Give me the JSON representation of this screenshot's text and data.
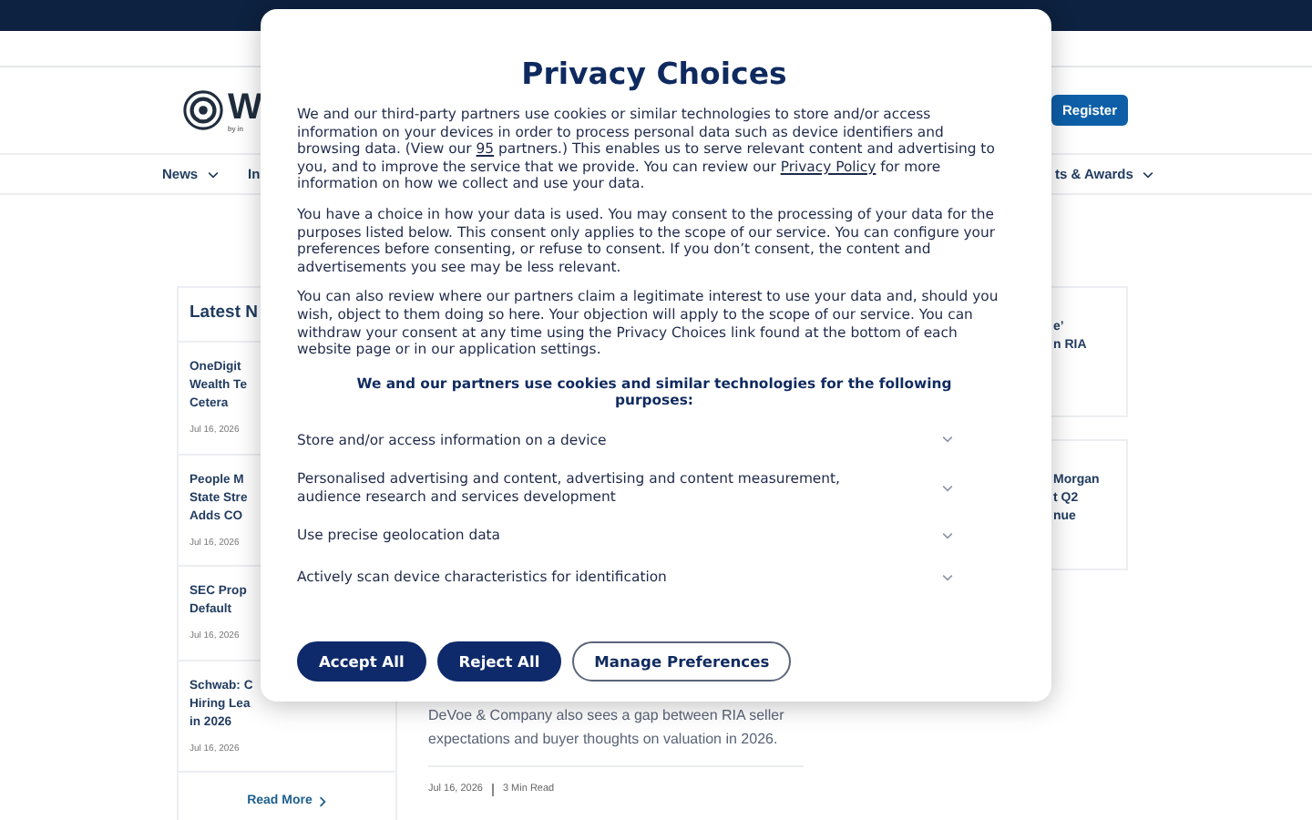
{
  "site": {
    "logo_letter": "W",
    "logo_tagline": "by in",
    "register": "Register",
    "nav": [
      {
        "label": "News",
        "dropdown": true
      },
      {
        "label": "In",
        "dropdown": false
      },
      {
        "label": "ts & Awards",
        "dropdown": true
      }
    ]
  },
  "latest": {
    "title": "Latest N",
    "items": [
      {
        "lines": [
          "OneDigit",
          "Wealth Te",
          "Cetera"
        ],
        "date": "Jul 16, 2026"
      },
      {
        "lines": [
          "People M",
          "State Stre",
          "Adds CO"
        ],
        "date": "Jul 16, 2026"
      },
      {
        "lines": [
          "SEC Prop",
          "Default"
        ],
        "date": "Jul 16, 2026"
      },
      {
        "lines": [
          "Schwab: C",
          "Hiring Lea",
          "in 2026"
        ],
        "date": "Jul 16, 2026"
      }
    ],
    "read_more": "Read More"
  },
  "right_cards": [
    {
      "lines": [
        "e’",
        "n RIA"
      ]
    },
    {
      "lines": [
        "Morgan",
        "t Q2",
        "nue"
      ]
    }
  ],
  "article": {
    "summary": "DeVoe & Company also sees a gap between RIA seller expectations and buyer thoughts on valuation in 2026.",
    "date": "Jul 16, 2026",
    "read_time": "3 Min Read"
  },
  "dialog": {
    "title": "Privacy Choices",
    "paragraphs": [
      [
        {
          "kind": "text",
          "text": "We and our third-party partners use cookies or similar technologies to store and/or access information on your devices in order to process personal data such as device identifiers and browsing data. (View our "
        },
        {
          "kind": "link",
          "text": "95"
        },
        {
          "kind": "text",
          "text": " partners.) This enables us to serve relevant content and advertising to you, and to improve the service that we provide. You can review our "
        },
        {
          "kind": "link",
          "text": "Privacy Policy"
        },
        {
          "kind": "text",
          "text": " for more information on how we collect and use your data."
        }
      ],
      [
        {
          "kind": "text",
          "text": "You have a choice in how your data is used. You may consent to the processing of your data for the purposes listed below. This consent only applies to the scope of our service. You can configure your preferences before consenting, or refuse to consent. If you don’t consent, the content and advertisements you see may be less relevant."
        }
      ],
      [
        {
          "kind": "text",
          "text": "You can also review where our partners claim a legitimate interest to use your data and, should you wish, object to them doing so here. Your objection will apply to the scope of our service. You can withdraw your consent at any time using the Privacy Choices link found at the bottom of each website page or in our application settings."
        }
      ]
    ],
    "purposes_heading": "We and our partners use cookies and similar technologies for the following purposes:",
    "purposes": [
      {
        "label": "Store and/or access information on a device",
        "expanded": false
      },
      {
        "label": "Personalised advertising and content, advertising and content measurement, audience research and services development",
        "expanded": false
      },
      {
        "label": "Use precise geolocation data",
        "expanded": false
      },
      {
        "label": "Actively scan device characteristics for identification",
        "expanded": false
      }
    ],
    "buttons": [
      {
        "label": "Accept All",
        "kind": "primary"
      },
      {
        "label": "Reject All",
        "kind": "primary"
      },
      {
        "label": "Manage Preferences",
        "kind": "outline"
      }
    ]
  }
}
